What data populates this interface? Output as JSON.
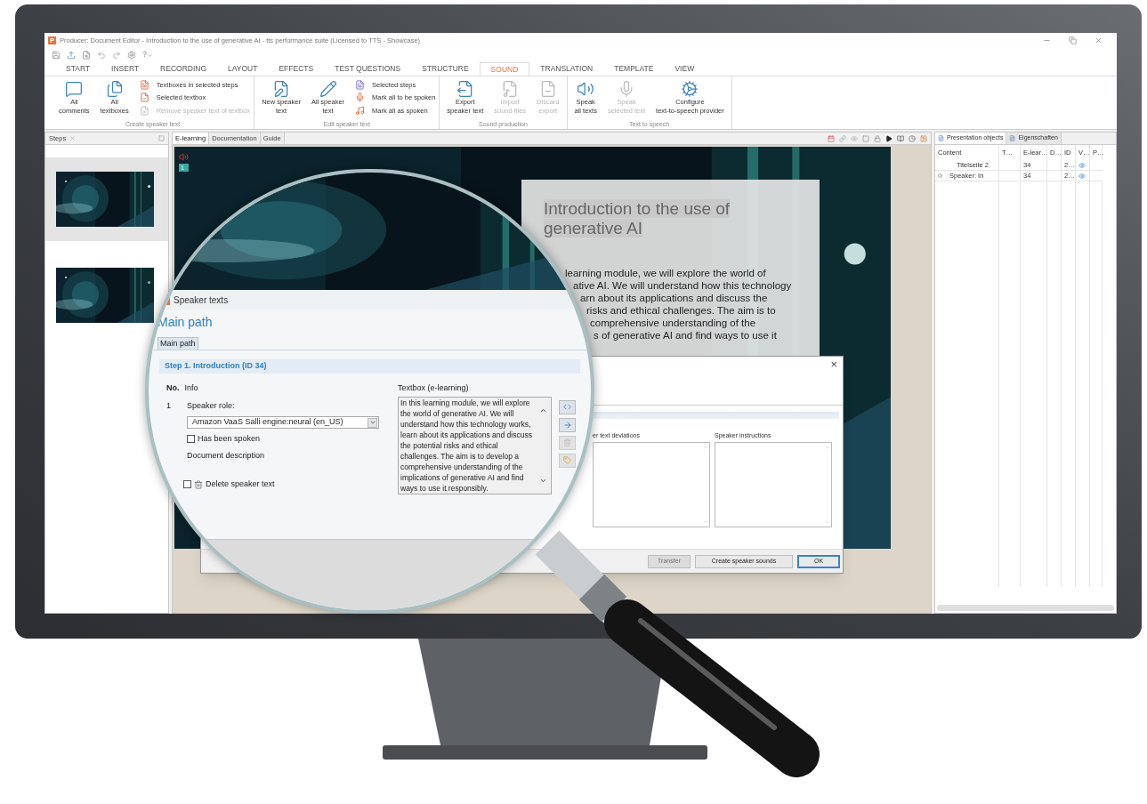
{
  "window": {
    "app_icon": "P",
    "title": "Producer: Document Editor - Introduction to the use of generative AI - tts performance suite (Licensed to TTS - Showcase)"
  },
  "quick_access": {
    "help": "?"
  },
  "ribbon_tabs": [
    {
      "label": "START",
      "selected": false
    },
    {
      "label": "INSERT",
      "selected": false
    },
    {
      "label": "RECORDING",
      "selected": false
    },
    {
      "label": "LAYOUT",
      "selected": false
    },
    {
      "label": "EFFECTS",
      "selected": false
    },
    {
      "label": "TEST QUESTIONS",
      "selected": false
    },
    {
      "label": "STRUCTURE",
      "selected": false
    },
    {
      "label": "SOUND",
      "selected": true
    },
    {
      "label": "TRANSLATION",
      "selected": false
    },
    {
      "label": "TEMPLATE",
      "selected": false
    },
    {
      "label": "VIEW",
      "selected": false
    }
  ],
  "ribbon_groups": [
    {
      "caption": "Create speaker text",
      "items": [
        {
          "kind": "large",
          "lines": [
            "All",
            "comments"
          ],
          "disabled": false
        },
        {
          "kind": "large",
          "lines": [
            "All",
            "textboxes"
          ],
          "disabled": false
        },
        {
          "kind": "small",
          "lines": [
            "Textboxes in selected steps"
          ],
          "disabled": false
        },
        {
          "kind": "small",
          "lines": [
            "Selected textbox"
          ],
          "disabled": false
        },
        {
          "kind": "small",
          "lines": [
            "Remove speaker text of textbox"
          ],
          "disabled": true
        }
      ]
    },
    {
      "caption": "Edit speaker text",
      "items": [
        {
          "kind": "large",
          "lines": [
            "New speaker",
            "text"
          ],
          "disabled": false
        },
        {
          "kind": "large",
          "lines": [
            "All speaker",
            "text"
          ],
          "disabled": false
        },
        {
          "kind": "small",
          "lines": [
            "Selected steps"
          ],
          "disabled": false
        },
        {
          "kind": "small",
          "lines": [
            "Mark all to be spoken"
          ],
          "disabled": false
        },
        {
          "kind": "small",
          "lines": [
            "Mark all as spoken"
          ],
          "disabled": false
        }
      ]
    },
    {
      "caption": "Sound production",
      "items": [
        {
          "kind": "large",
          "lines": [
            "Export",
            "speaker text"
          ],
          "disabled": false
        },
        {
          "kind": "large",
          "lines": [
            "Import",
            "sound files"
          ],
          "disabled": true
        },
        {
          "kind": "large",
          "lines": [
            "Discard",
            "export"
          ],
          "disabled": true
        }
      ]
    },
    {
      "caption": "Text to speech",
      "items": [
        {
          "kind": "large",
          "lines": [
            "Speak",
            "all texts"
          ],
          "disabled": false
        },
        {
          "kind": "large",
          "lines": [
            "Speak",
            "selected text"
          ],
          "disabled": true
        },
        {
          "kind": "large",
          "lines": [
            "Configure",
            "text-to-speech provider"
          ],
          "disabled": false
        }
      ]
    }
  ],
  "steps_panel": {
    "title": "Steps",
    "thumbnails": [
      {
        "kind": "picture",
        "selected": true
      },
      {
        "kind": "picture",
        "selected": false
      }
    ]
  },
  "editor": {
    "tabs": [
      {
        "label": "E-learning",
        "selected": true
      },
      {
        "label": "Documentation",
        "selected": false
      },
      {
        "label": "Guide",
        "selected": false
      }
    ],
    "slide": {
      "step_badge": "1",
      "title_lines": [
        "Introduction to the use of",
        "generative AI"
      ],
      "body_lines": [
        "learning module, we will explore the world of",
        "ative AI. We will understand how this technology",
        "arn about its applications and discuss the",
        "risks and ethical challenges. The aim is to",
        "comprehensive understanding of the",
        "s of generative AI and find ways to use it"
      ]
    }
  },
  "dialog": {
    "close": "×",
    "fields": [
      {
        "label": "er text deviations"
      },
      {
        "label": "Speaker instructions"
      }
    ],
    "buttons": [
      {
        "label": "Transfer",
        "disabled": true,
        "default": false
      },
      {
        "label": "Create speaker sounds",
        "disabled": false,
        "default": false
      },
      {
        "label": "OK",
        "disabled": false,
        "default": true
      }
    ]
  },
  "magnified": {
    "title": "Speaker texts",
    "heading": "Main path",
    "tabs": [
      {
        "label": "Main path",
        "selected": true
      }
    ],
    "step_title": "Step 1. Introduction (ID 34)",
    "col_no": "No.",
    "col_info": "Info",
    "col_textbox": "Textbox (e-learning)",
    "entries": [
      {
        "no": "1",
        "role_label": "Speaker role:",
        "role_value": "Amazon VaaS Salli engine:neural (en_US)",
        "spoken_label": "Has been spoken",
        "spoken": false,
        "description_label": "Document description",
        "delete_label": "Delete speaker text",
        "delete": false,
        "text": "In this learning module, we will explore the world of generative AI. We will understand how this technology works, learn about its applications and discuss the potential risks and ethical challenges. The aim is to develop a comprehensive understanding of the implications of generative AI and find ways to use it responsibly."
      }
    ]
  },
  "objects_panel": {
    "tabs": [
      {
        "label": "Presentation objects",
        "selected": true
      },
      {
        "label": "Eigenschaften",
        "selected": false
      }
    ],
    "columns": [
      "Content",
      "T…",
      "E-lear…",
      "D…",
      "ID",
      "V…",
      "P…"
    ],
    "rows": [
      {
        "kind": "page",
        "content": "Titelseite 2",
        "cells": [
          "",
          "34",
          "",
          "2…"
        ]
      },
      {
        "kind": "speaker",
        "content": "Speaker: In",
        "cells": [
          "",
          "34",
          "",
          "2…"
        ]
      }
    ]
  }
}
